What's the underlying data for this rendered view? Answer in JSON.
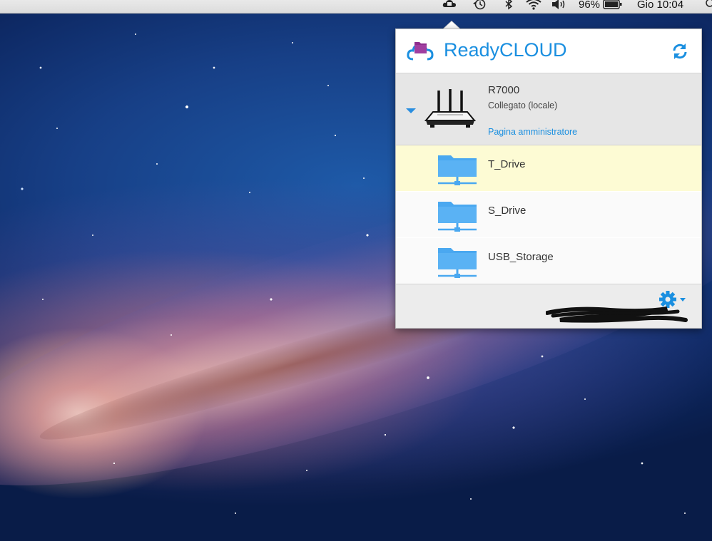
{
  "menubar": {
    "battery_percent": "96%",
    "clock": "Gio 10:04",
    "icons": [
      "readycloud-menu-icon",
      "time-machine-icon",
      "bluetooth-icon",
      "wifi-icon",
      "volume-icon",
      "battery-icon"
    ]
  },
  "popover": {
    "app_title": "ReadyCLOUD",
    "device": {
      "name": "R7000",
      "status": "Collegato (locale)",
      "admin_link": "Pagina amministratore"
    },
    "shares": [
      {
        "label": "T_Drive",
        "selected": true
      },
      {
        "label": "S_Drive",
        "selected": false
      },
      {
        "label": "USB_Storage",
        "selected": false
      }
    ]
  },
  "colors": {
    "accent": "#1a8fe0",
    "folder": "#4aa8f0",
    "selected_row": "#fdfbd4",
    "logo_folder": "#8e2d8e"
  }
}
